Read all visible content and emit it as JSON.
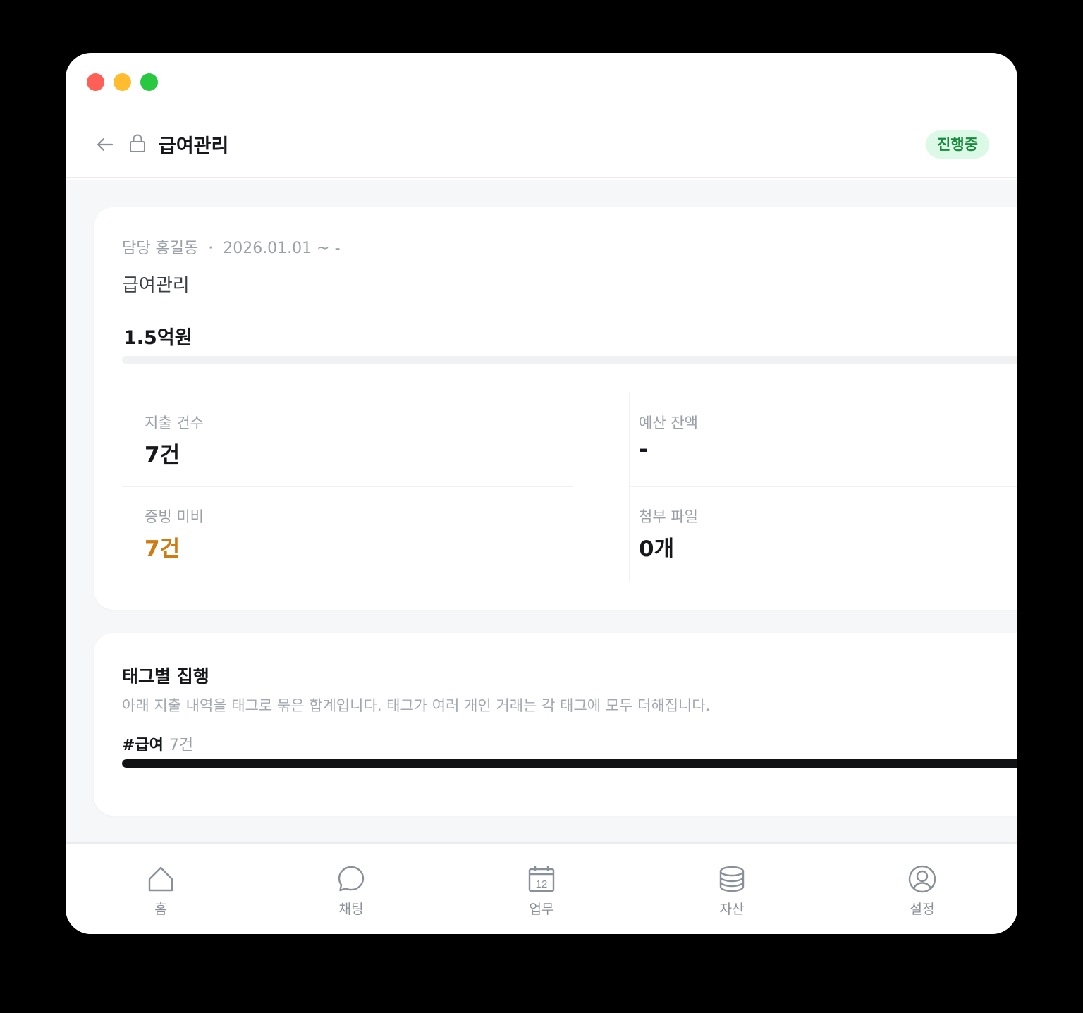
{
  "header": {
    "title": "급여관리",
    "status_badge": "진행중"
  },
  "summary": {
    "owner_label": "담당 홍길동",
    "separator": "·",
    "period": "2026.01.01 ~ -",
    "description": "급여관리",
    "amount": "1.5억원",
    "progress_fraction": 0.0
  },
  "stats": {
    "expense_count": {
      "label": "지출 건수",
      "value": "7건"
    },
    "budget_balance": {
      "label": "예산 잔액",
      "value": "-"
    },
    "missing_proof": {
      "label": "증빙 미비",
      "value": "7건"
    },
    "attachments": {
      "label": "첨부 파일",
      "value": "0개"
    }
  },
  "tag_section": {
    "title": "태그별 집행",
    "subtitle": "아래 지출 내역을 태그로 묶은 합계입니다. 태그가 여러 개인 거래는 각 태그에 모두 더해집니다.",
    "tags": [
      {
        "name": "#급여",
        "count": "7건",
        "fraction": 1.0
      }
    ]
  },
  "tabbar": {
    "items": [
      {
        "label": "홈",
        "icon": "home-icon"
      },
      {
        "label": "채팅",
        "icon": "chat-icon"
      },
      {
        "label": "업무",
        "icon": "calendar-icon",
        "icon_text": "12"
      },
      {
        "label": "자산",
        "icon": "database-icon"
      },
      {
        "label": "설정",
        "icon": "user-circle-icon"
      }
    ]
  },
  "colors": {
    "badge_bg": "#dcf8e6",
    "badge_text": "#1a8a3d",
    "warning": "#d07a12",
    "primary_text": "#16181c"
  }
}
